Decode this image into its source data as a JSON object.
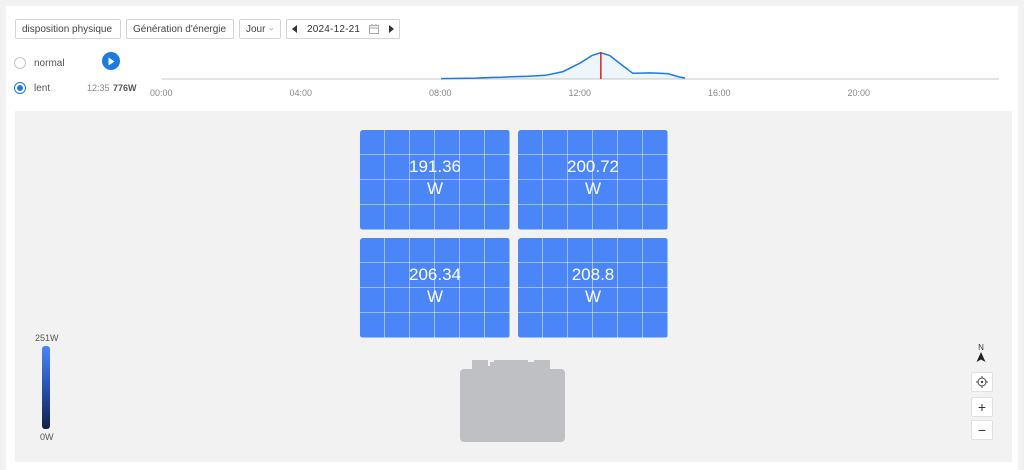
{
  "toolbar": {
    "layout_select": "disposition physique",
    "metric_select": "Génération d'énergie",
    "period_select": "Jour",
    "date": "2024-12-21"
  },
  "playback": {
    "mode_normal": "normal",
    "mode_slow": "lent",
    "selected_mode": "lent",
    "current_time": "12:35",
    "current_power": "776W"
  },
  "timeline": {
    "ticks": [
      "00:00",
      "04:00",
      "08:00",
      "12:00",
      "16:00",
      "20:00"
    ],
    "cursor_time": "12:35",
    "curve": [
      {
        "t": "08:00",
        "w": 12
      },
      {
        "t": "08:30",
        "w": 18
      },
      {
        "t": "09:00",
        "w": 28
      },
      {
        "t": "09:30",
        "w": 48
      },
      {
        "t": "09:45",
        "w": 52
      },
      {
        "t": "10:00",
        "w": 65
      },
      {
        "t": "10:30",
        "w": 80
      },
      {
        "t": "11:00",
        "w": 110
      },
      {
        "t": "11:30",
        "w": 220
      },
      {
        "t": "12:00",
        "w": 480
      },
      {
        "t": "12:20",
        "w": 700
      },
      {
        "t": "12:35",
        "w": 776
      },
      {
        "t": "12:50",
        "w": 700
      },
      {
        "t": "13:10",
        "w": 430
      },
      {
        "t": "13:30",
        "w": 170
      },
      {
        "t": "14:00",
        "w": 180
      },
      {
        "t": "14:30",
        "w": 160
      },
      {
        "t": "14:50",
        "w": 60
      },
      {
        "t": "15:00",
        "w": 30
      }
    ]
  },
  "panels": [
    {
      "value": "191.36",
      "unit": "W"
    },
    {
      "value": "200.72",
      "unit": "W"
    },
    {
      "value": "206.34",
      "unit": "W"
    },
    {
      "value": "208.8",
      "unit": "W"
    }
  ],
  "legend": {
    "max": "251W",
    "min": "0W",
    "color_high": "#4a86f7",
    "color_low": "#13204a"
  },
  "map_controls": {
    "north": "N",
    "locate": "crosshair-icon",
    "zoom_in": "+",
    "zoom_out": "−"
  },
  "colors": {
    "accent": "#1f7ae0",
    "panel": "#4a86f7",
    "cursor": "#e02020",
    "inverter": "#bfc0c4"
  }
}
